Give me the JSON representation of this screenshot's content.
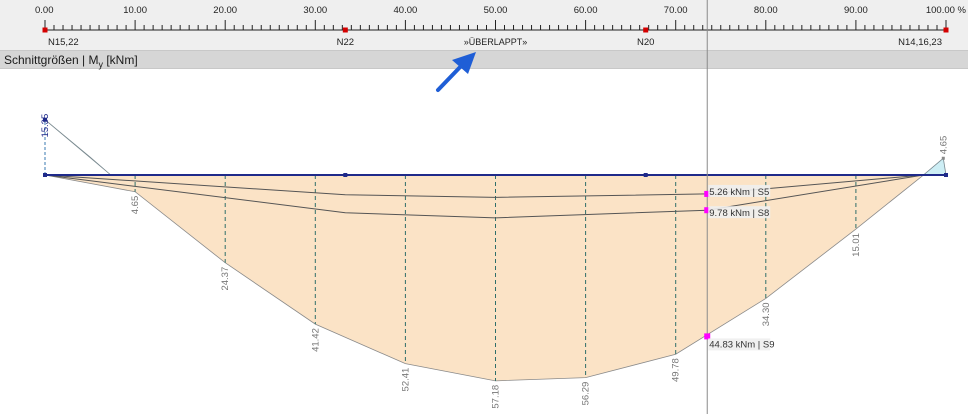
{
  "ruler": {
    "ticks": [
      "0.00",
      "10.00",
      "20.00",
      "30.00",
      "40.00",
      "50.00",
      "60.00",
      "70.00",
      "80.00",
      "90.00",
      "100.00 %"
    ],
    "nodes": [
      {
        "pos": 0,
        "label": "N15,22"
      },
      {
        "pos": 33.33,
        "label": "N22"
      },
      {
        "pos": 66.67,
        "label": "N20"
      },
      {
        "pos": 100,
        "label": "N14,16,23"
      }
    ],
    "overlap_label": "»ÜBERLAPPT»",
    "overlap_pos": 50
  },
  "panel": {
    "title_prefix": "Schnittgrößen | M",
    "title_sub": "y",
    "title_unit": " [kNm]"
  },
  "chart_data": {
    "type": "area",
    "title": "Schnittgrößen | My [kNm]",
    "x_unit": "%",
    "xlim": [
      0,
      100
    ],
    "envelope_label_pos": [
      {
        "x": 10,
        "y": 4.65
      },
      {
        "x": 20,
        "y": -24.37
      },
      {
        "x": 30,
        "y": -41.42
      },
      {
        "x": 40,
        "y": -52.41
      },
      {
        "x": 50,
        "y": -57.18
      },
      {
        "x": 60,
        "y": -56.29
      },
      {
        "x": 70,
        "y": -49.78
      },
      {
        "x": 80,
        "y": -34.3
      },
      {
        "x": 90,
        "y": -15.01
      }
    ],
    "labels_printed": [
      "15.35",
      "4.65",
      "24.37",
      "41.42",
      "52.41",
      "57.18",
      "56.29",
      "49.78",
      "34.30",
      "15.01",
      "4.65"
    ],
    "envelope_upper": [
      {
        "x": 0,
        "y": 15.35
      },
      {
        "x": 5,
        "y": 5
      },
      {
        "x": 7.3,
        "y": 0
      },
      {
        "x": 100,
        "y": 0
      },
      {
        "x": 99.7,
        "y": 4.65
      },
      {
        "x": 97.5,
        "y": 0
      }
    ],
    "envelope_lower": [
      {
        "x": 0,
        "y": 0
      },
      {
        "x": 10,
        "y": -4.65
      },
      {
        "x": 20,
        "y": -24.37
      },
      {
        "x": 30,
        "y": -41.42
      },
      {
        "x": 40,
        "y": -52.41
      },
      {
        "x": 50,
        "y": -57.18
      },
      {
        "x": 60,
        "y": -56.29
      },
      {
        "x": 70,
        "y": -49.78
      },
      {
        "x": 80,
        "y": -34.3
      },
      {
        "x": 90,
        "y": -15.01
      },
      {
        "x": 97.5,
        "y": 0
      }
    ],
    "series": [
      {
        "name": "S5",
        "points": [
          {
            "x": 0,
            "y": 0
          },
          {
            "x": 33.33,
            "y": -5.5
          },
          {
            "x": 50,
            "y": -6.2
          },
          {
            "x": 73.5,
            "y": -5.26
          },
          {
            "x": 97.5,
            "y": 0
          }
        ]
      },
      {
        "name": "S8",
        "points": [
          {
            "x": 0,
            "y": 0
          },
          {
            "x": 33.33,
            "y": -10.5
          },
          {
            "x": 50,
            "y": -11.9
          },
          {
            "x": 73.5,
            "y": -9.78
          },
          {
            "x": 97.5,
            "y": 0
          }
        ]
      },
      {
        "name": "S9",
        "points": [
          {
            "x": 73.5,
            "y": -44.83
          }
        ]
      }
    ],
    "cursor": {
      "x": 73.5,
      "readouts": [
        {
          "text": "5.26 kNm | S5",
          "y": -5.26
        },
        {
          "text": "9.78 kNm | S8",
          "y": -9.78
        },
        {
          "text": "44.83 kNm | S9",
          "y": -44.83
        }
      ]
    }
  },
  "colors": {
    "negative_fill": "#fbe3c6",
    "positive_fill": "#cdeef5",
    "axis": "#1f2a8a",
    "node": "#d40000",
    "marker": "#ff00ff",
    "arrow": "#1f5ed6"
  }
}
